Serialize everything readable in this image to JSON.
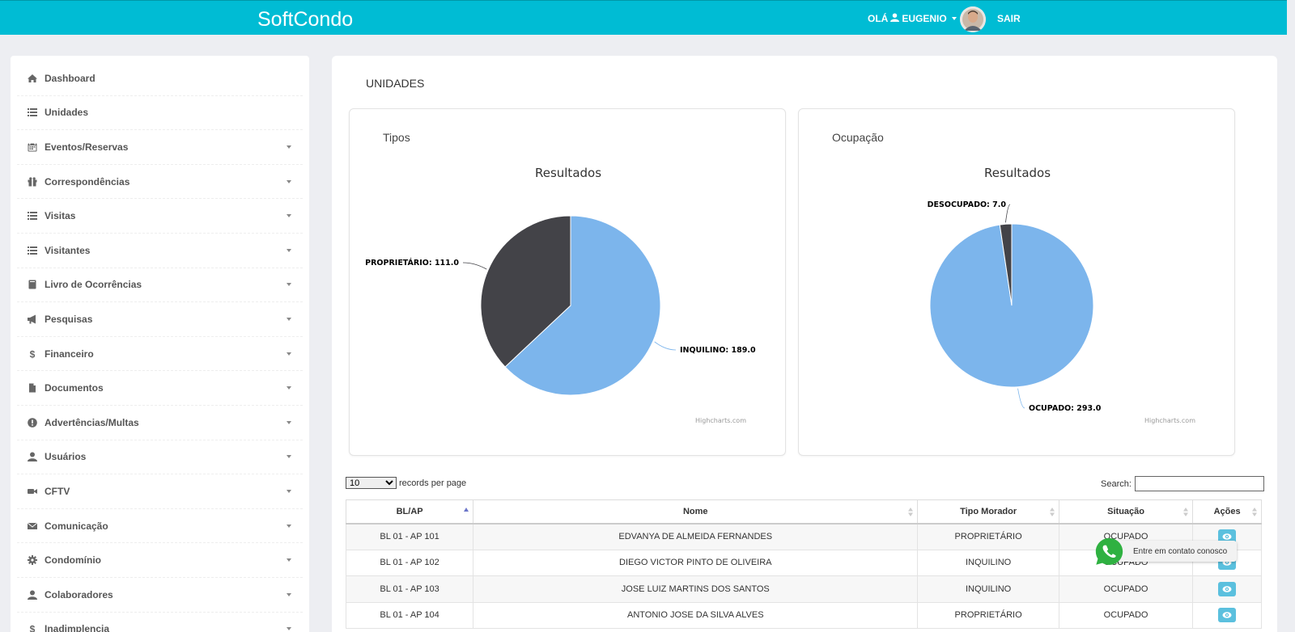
{
  "header": {
    "brand": "SoftCondo",
    "greeting": "OLÁ",
    "user_name": "EUGENIO",
    "logout_label": "SAIR"
  },
  "sidebar": {
    "items": [
      {
        "label": "Dashboard",
        "icon": "home-icon",
        "has_dropdown": false
      },
      {
        "label": "Unidades",
        "icon": "list-icon",
        "has_dropdown": false
      },
      {
        "label": "Eventos/Reservas",
        "icon": "calendar-icon",
        "has_dropdown": true
      },
      {
        "label": "Correspondências",
        "icon": "gift-icon",
        "has_dropdown": true
      },
      {
        "label": "Visitas",
        "icon": "list-icon",
        "has_dropdown": true
      },
      {
        "label": "Visitantes",
        "icon": "list-icon",
        "has_dropdown": true
      },
      {
        "label": "Livro de Ocorrências",
        "icon": "book-icon",
        "has_dropdown": true
      },
      {
        "label": "Pesquisas",
        "icon": "bullhorn-icon",
        "has_dropdown": true
      },
      {
        "label": "Financeiro",
        "icon": "dollar-icon",
        "has_dropdown": true
      },
      {
        "label": "Documentos",
        "icon": "file-icon",
        "has_dropdown": true
      },
      {
        "label": "Advertências/Multas",
        "icon": "exclamation-icon",
        "has_dropdown": true
      },
      {
        "label": "Usuários",
        "icon": "user-icon",
        "has_dropdown": true
      },
      {
        "label": "CFTV",
        "icon": "camera-icon",
        "has_dropdown": true
      },
      {
        "label": "Comunicação",
        "icon": "envelope-icon",
        "has_dropdown": true
      },
      {
        "label": "Condomínio",
        "icon": "cog-icon",
        "has_dropdown": true
      },
      {
        "label": "Colaboradores",
        "icon": "user-icon",
        "has_dropdown": true
      },
      {
        "label": "Inadimplencia",
        "icon": "dollar-icon",
        "has_dropdown": true
      }
    ]
  },
  "main": {
    "title": "UNIDADES",
    "length_value": "10",
    "length_suffix": "records per page",
    "search_label": "Search:",
    "search_value": ""
  },
  "chart_data": [
    {
      "type": "pie",
      "card_title": "Tipos",
      "title": "Resultados",
      "slices": [
        {
          "label": "INQUILINO",
          "value": 189.0,
          "color": "#7cb5ec"
        },
        {
          "label": "PROPRIETÁRIO",
          "value": 111.0,
          "color": "#434348"
        }
      ],
      "slice_labels": [
        "INQUILINO: 189.0",
        "PROPRIETÁRIO: 111.0"
      ],
      "credits": "Highcharts.com"
    },
    {
      "type": "pie",
      "card_title": "Ocupação",
      "title": "Resultados",
      "slices": [
        {
          "label": "OCUPADO",
          "value": 293.0,
          "color": "#7cb5ec"
        },
        {
          "label": "DESOCUPADO",
          "value": 7.0,
          "color": "#434348"
        }
      ],
      "slice_labels": [
        "OCUPADO: 293.0",
        "DESOCUPADO: 7.0"
      ],
      "credits": "Highcharts.com"
    }
  ],
  "table": {
    "columns": [
      "BL/AP",
      "Nome",
      "Tipo Morador",
      "Situação",
      "Ações"
    ],
    "rows": [
      [
        "BL 01 - AP 101",
        "EDVANYA DE ALMEIDA FERNANDES",
        "PROPRIETÁRIO",
        "OCUPADO"
      ],
      [
        "BL 01 - AP 102",
        "DIEGO VICTOR PINTO DE OLIVEIRA",
        "INQUILINO",
        "OCUPADO"
      ],
      [
        "BL 01 - AP 103",
        "JOSE LUIZ MARTINS DOS SANTOS",
        "INQUILINO",
        "OCUPADO"
      ],
      [
        "BL 01 - AP 104",
        "ANTONIO JOSE DA SILVA ALVES",
        "PROPRIETÁRIO",
        "OCUPADO"
      ]
    ]
  },
  "whatsapp": {
    "label": "Entre em contato conosco"
  }
}
